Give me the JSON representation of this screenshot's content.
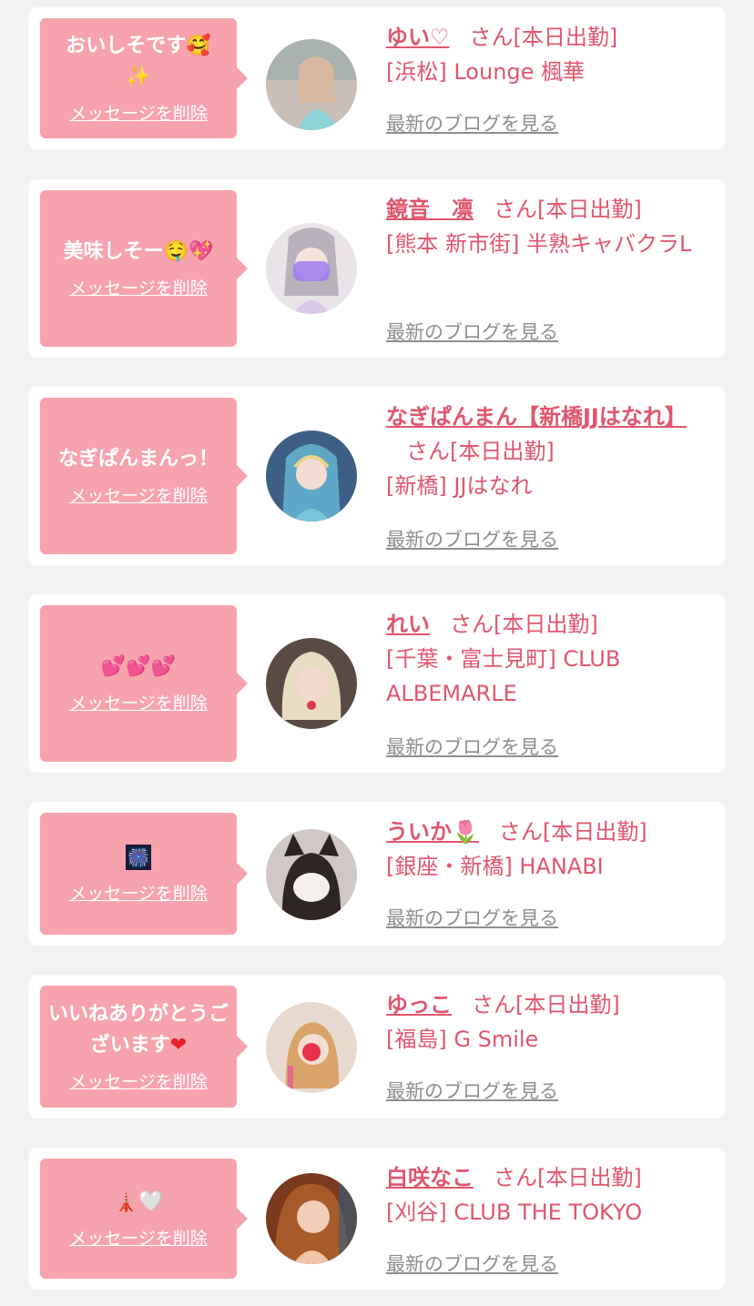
{
  "common": {
    "delete_label": "メッセージを削除",
    "blog_label": "最新のブログを見る"
  },
  "cards": [
    {
      "message": "おいしそです",
      "emoji_a": "🥰",
      "emoji_b": "✨",
      "name": "ゆい♡",
      "honorific": "さん[本日出勤]",
      "shop": "[浜松] Lounge 楓華"
    },
    {
      "message": "美味しそー",
      "emoji_a": "🤤",
      "emoji_b": "💖",
      "name": "鏡音　凛",
      "honorific": "さん[本日出勤]",
      "shop": "[熊本 新市街] 半熟キャバクラL"
    },
    {
      "message": "なぎぱんまんっ！",
      "name": "なぎぱんまん【新橋JJはなれ】",
      "honorific": "さん[本日出勤]",
      "shop": "[新橋] JJはなれ"
    },
    {
      "emoji_a": "💕",
      "emoji_b": "💕",
      "emoji_c": "💕",
      "name": "れい",
      "honorific": "さん[本日出勤]",
      "shop": "[千葉・富士見町] CLUB ALBEMARLE"
    },
    {
      "emoji_a": "🎆",
      "name": "ういか",
      "name_emoji": "🌷",
      "honorific": "さん[本日出勤]",
      "shop": "[銀座・新橋] HANABI"
    },
    {
      "message": "いいねありがとうございます",
      "emoji_a": "❤",
      "name": "ゆっこ",
      "honorific": "さん[本日出勤]",
      "shop": "[福島] G Smile"
    },
    {
      "emoji_a": "🗼",
      "emoji_b": "🤍",
      "name": "白咲なこ",
      "honorific": "さん[本日出勤]",
      "shop": "[刈谷] CLUB THE TOKYO"
    }
  ]
}
